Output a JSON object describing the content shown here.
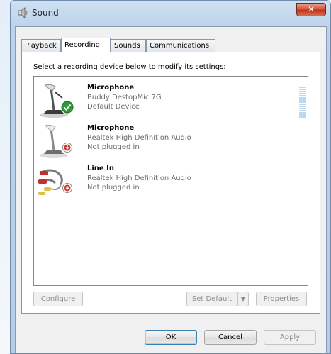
{
  "window": {
    "title": "Sound"
  },
  "tabs": [
    {
      "label": "Playback"
    },
    {
      "label": "Recording"
    },
    {
      "label": "Sounds"
    },
    {
      "label": "Communications"
    }
  ],
  "instruction": "Select a recording device below to modify its settings:",
  "devices": [
    {
      "name": "Microphone",
      "description": "Buddy DestopMic 7G",
      "status": "Default Device",
      "icon": "microphone-icon",
      "badge": "default-check-icon"
    },
    {
      "name": "Microphone",
      "description": "Realtek High Definition Audio",
      "status": "Not plugged in",
      "icon": "microphone-icon",
      "badge": "unplugged-icon"
    },
    {
      "name": "Line In",
      "description": "Realtek High Definition Audio",
      "status": "Not plugged in",
      "icon": "line-in-cable-icon",
      "badge": "unplugged-icon"
    }
  ],
  "buttons": {
    "configure": "Configure",
    "set_default": "Set Default",
    "properties": "Properties",
    "ok": "OK",
    "cancel": "Cancel",
    "apply": "Apply"
  },
  "colors": {
    "check": "#2e9b3a",
    "unplugged": "#c0392b",
    "level": "#bcd8ee"
  }
}
